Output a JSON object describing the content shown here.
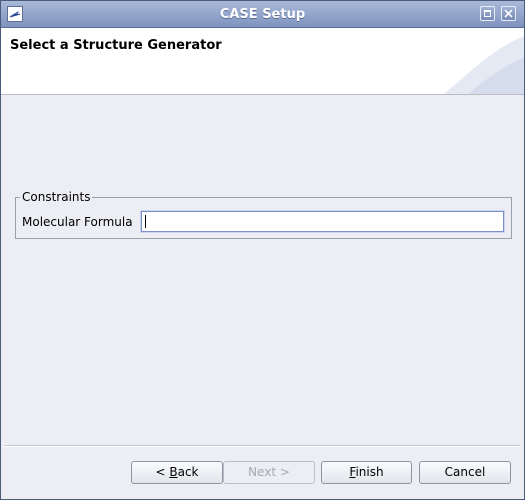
{
  "window": {
    "title": "CASE Setup"
  },
  "header": {
    "title": "Select a Structure Generator"
  },
  "constraints": {
    "legend": "Constraints",
    "molecular_formula": {
      "label": "Molecular Formula",
      "value": ""
    }
  },
  "buttons": {
    "back": {
      "prefix": "< ",
      "mnemonic": "B",
      "rest": "ack"
    },
    "next": {
      "label": "Next >",
      "enabled": false
    },
    "finish": {
      "mnemonic": "F",
      "rest": "inish"
    },
    "cancel": {
      "label": "Cancel"
    }
  },
  "colors": {
    "titlebar": "#8fa2cb",
    "accent_focus": "#7b8fc8",
    "disabled_text": "#a4a8b0"
  }
}
